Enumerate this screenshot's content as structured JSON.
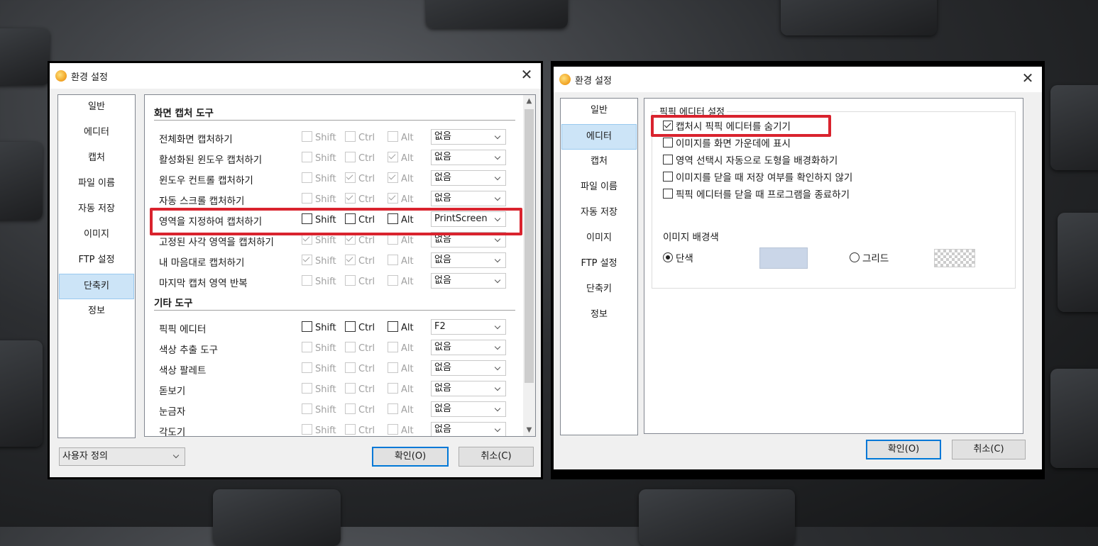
{
  "left_window": {
    "title": "환경 설정",
    "close": "✕",
    "nav": [
      "일반",
      "에디터",
      "캡처",
      "파일 이름",
      "자동 저장",
      "이미지",
      "FTP 설정",
      "단축키",
      "정보"
    ],
    "nav_selected": "단축키",
    "modifier_labels": {
      "shift": "Shift",
      "ctrl": "Ctrl",
      "alt": "Alt"
    },
    "sections": [
      {
        "title": "화면 캡처 도구",
        "rows": [
          {
            "label": "전체화면 캡처하기",
            "shift": false,
            "ctrl": false,
            "alt": false,
            "key": "없음",
            "enabled": false
          },
          {
            "label": "활성화된 윈도우 캡처하기",
            "shift": false,
            "ctrl": false,
            "alt": true,
            "key": "없음",
            "enabled": false
          },
          {
            "label": "윈도우 컨트롤 캡처하기",
            "shift": false,
            "ctrl": true,
            "alt": true,
            "key": "없음",
            "enabled": false
          },
          {
            "label": "자동 스크롤 캡처하기",
            "shift": false,
            "ctrl": true,
            "alt": true,
            "key": "없음",
            "enabled": false
          },
          {
            "label": "영역을 지정하여 캡처하기",
            "shift": false,
            "ctrl": false,
            "alt": false,
            "key": "PrintScreen",
            "enabled": true
          },
          {
            "label": "고정된 사각 영역을 캡처하기",
            "shift": true,
            "ctrl": true,
            "alt": false,
            "key": "없음",
            "enabled": false
          },
          {
            "label": "내 마음대로 캡처하기",
            "shift": true,
            "ctrl": true,
            "alt": false,
            "key": "없음",
            "enabled": false
          },
          {
            "label": "마지막 캡처 영역 반복",
            "shift": false,
            "ctrl": false,
            "alt": false,
            "key": "없음",
            "enabled": false
          }
        ]
      },
      {
        "title": "기타 도구",
        "rows": [
          {
            "label": "픽픽 에디터",
            "shift": false,
            "ctrl": false,
            "alt": false,
            "key": "F2",
            "enabled": true
          },
          {
            "label": "색상 추출 도구",
            "shift": false,
            "ctrl": false,
            "alt": false,
            "key": "없음",
            "enabled": false
          },
          {
            "label": "색상 팔레트",
            "shift": false,
            "ctrl": false,
            "alt": false,
            "key": "없음",
            "enabled": false
          },
          {
            "label": "돋보기",
            "shift": false,
            "ctrl": false,
            "alt": false,
            "key": "없음",
            "enabled": false
          },
          {
            "label": "눈금자",
            "shift": false,
            "ctrl": false,
            "alt": false,
            "key": "없음",
            "enabled": false
          },
          {
            "label": "각도기",
            "shift": false,
            "ctrl": false,
            "alt": false,
            "key": "없음",
            "enabled": false
          }
        ]
      }
    ],
    "preset": "사용자 정의",
    "ok": "확인(O)",
    "cancel": "취소(C)"
  },
  "right_window": {
    "title": "환경 설정",
    "close": "✕",
    "nav": [
      "일반",
      "에디터",
      "캡처",
      "파일 이름",
      "자동 저장",
      "이미지",
      "FTP 설정",
      "단축키",
      "정보"
    ],
    "nav_selected": "에디터",
    "group_title": "픽픽 에디터 설정",
    "options": [
      {
        "label": "캡처시 픽픽 에디터를 숨기기",
        "checked": true
      },
      {
        "label": "이미지를 화면 가운데에 표시",
        "checked": false
      },
      {
        "label": "영역 선택시 자동으로 도형을 배경화하기",
        "checked": false
      },
      {
        "label": "이미지를 닫을 때 저장 여부를 확인하지 않기",
        "checked": false
      },
      {
        "label": "픽픽 에디터를 닫을 때 프로그램을 종료하기",
        "checked": false
      }
    ],
    "bg_label": "이미지 배경색",
    "bg_solid": "단색",
    "bg_grid": "그리드",
    "bg_selected": "단색",
    "solid_color": "#cad6e8",
    "ok": "확인(O)",
    "cancel": "취소(C)"
  },
  "highlight_color": "#d9232e"
}
